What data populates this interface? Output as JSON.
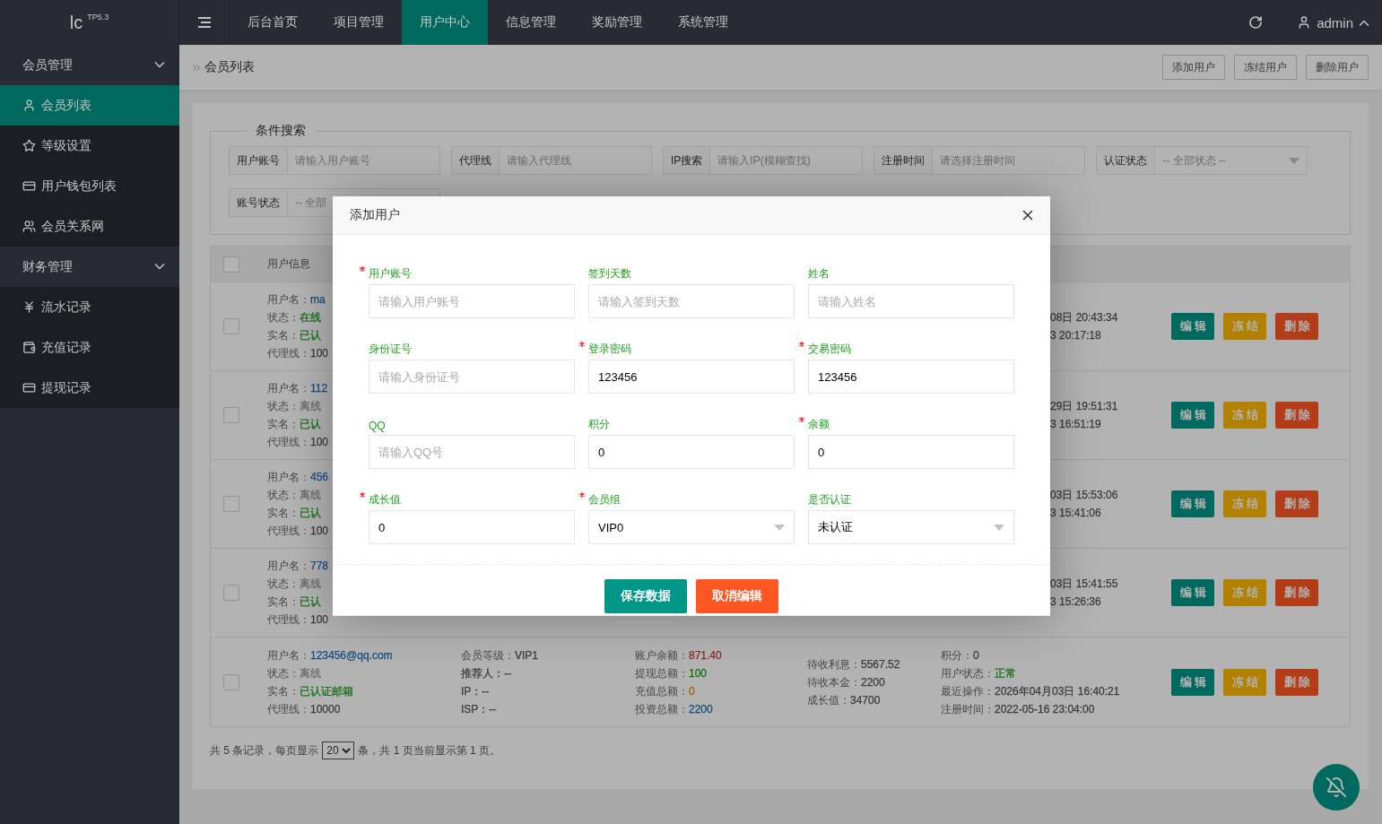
{
  "topbar": {
    "logo": "lc",
    "version": "TP5.3",
    "nav": [
      {
        "label": "后台首页",
        "selected": false
      },
      {
        "label": "项目管理",
        "selected": false
      },
      {
        "label": "用户中心",
        "selected": true
      },
      {
        "label": "信息管理",
        "selected": false
      },
      {
        "label": "奖励管理",
        "selected": false
      },
      {
        "label": "系统管理",
        "selected": false
      }
    ],
    "user": "admin"
  },
  "sidebar": {
    "groups": [
      {
        "label": "会员管理",
        "expanded": true,
        "children": [
          {
            "label": "会员列表",
            "selected": true
          },
          {
            "label": "等级设置",
            "selected": false
          },
          {
            "label": "用户钱包列表",
            "selected": false
          },
          {
            "label": "会员关系网",
            "selected": false
          }
        ]
      },
      {
        "label": "财务管理",
        "expanded": true,
        "children": [
          {
            "label": "流水记录",
            "selected": false
          },
          {
            "label": "充值记录",
            "selected": false
          },
          {
            "label": "提现记录",
            "selected": false
          }
        ]
      }
    ]
  },
  "breadcrumb": "会员列表",
  "toolbar_buttons": [
    "添加用户",
    "冻结用户",
    "删除用户"
  ],
  "search": {
    "legend": "条件搜索",
    "rows": [
      [
        {
          "label": "用户账号",
          "kind": "input",
          "placeholder": "请输入用户账号"
        },
        {
          "label": "代理线",
          "kind": "input",
          "placeholder": "请输入代理线"
        },
        {
          "label": "IP搜索",
          "kind": "input",
          "placeholder": "请输入IP(模糊查找)"
        },
        {
          "label": "注册时间",
          "kind": "input",
          "placeholder": "请选择注册时间"
        },
        {
          "label": "认证状态",
          "kind": "select",
          "value": "-- 全部状态 --"
        }
      ],
      [
        {
          "label": "账号状态",
          "kind": "select_cut",
          "value": "-- 全部"
        }
      ]
    ]
  },
  "table": {
    "header_checked": false,
    "columns": [
      "用户信息"
    ],
    "rows": [
      {
        "kind": "partial",
        "checked": false,
        "cells": [
          [
            {
              "label": "用户名：",
              "value": "ma",
              "color": "#154d81"
            },
            {
              "label": "状态：",
              "value": "在线",
              "color": "#126d12"
            },
            {
              "label": "实名：",
              "value": "已认",
              "color": "#126d12"
            },
            {
              "label": "代理线：",
              "value": "100",
              "color": "#3b3b3b"
            }
          ],
          [
            {
              "value": "08日 20:43:34"
            },
            {
              "value": "3 20:17:18"
            }
          ]
        ],
        "actions": [
          "编辑",
          "冻结",
          "删除"
        ]
      },
      {
        "kind": "partial",
        "checked": false,
        "cells": [
          [
            {
              "label": "用户名：",
              "value": "112",
              "color": "#154d81"
            },
            {
              "label": "状态：",
              "value": "离线",
              "color": "#6b6b6b"
            },
            {
              "label": "实名：",
              "value": "已认",
              "color": "#126d12"
            },
            {
              "label": "代理线：",
              "value": "100",
              "color": "#3b3b3b"
            }
          ],
          [
            {
              "value": "29日 19:51:31"
            },
            {
              "value": "3 16:51:19"
            }
          ]
        ],
        "actions": [
          "编辑",
          "冻结",
          "删除"
        ]
      },
      {
        "kind": "partial",
        "checked": false,
        "cells": [
          [
            {
              "label": "用户名：",
              "value": "456",
              "color": "#154d81"
            },
            {
              "label": "状态：",
              "value": "离线",
              "color": "#6b6b6b"
            },
            {
              "label": "实名：",
              "value": "已认",
              "color": "#126d12"
            },
            {
              "label": "代理线：",
              "value": "100",
              "color": "#3b3b3b"
            }
          ],
          [
            {
              "value": "03日 15:53:06"
            },
            {
              "value": "3 15:41:06"
            }
          ]
        ],
        "actions": [
          "编辑",
          "冻结",
          "删除"
        ]
      },
      {
        "kind": "partial",
        "checked": false,
        "cells": [
          [
            {
              "label": "用户名：",
              "value": "778",
              "color": "#154d81"
            },
            {
              "label": "状态：",
              "value": "离线",
              "color": "#6b6b6b"
            },
            {
              "label": "实名：",
              "value": "已认",
              "color": "#126d12"
            },
            {
              "label": "代理线：",
              "value": "100",
              "color": "#3b3b3b"
            }
          ],
          [
            {
              "value": "03日 15:41:55"
            },
            {
              "value": "3 15:26:36"
            }
          ]
        ],
        "actions": [
          "编辑",
          "冻结",
          "删除"
        ]
      },
      {
        "kind": "full",
        "checked": false,
        "cells": [
          [
            {
              "label": "用户名：",
              "value": "123456@qq.com",
              "color": "#154d81"
            },
            {
              "label": "状态：",
              "value": "离线",
              "color": "#6b6b6b"
            },
            {
              "label": "实名：",
              "value": "已认证邮箱",
              "color": "#126d12"
            },
            {
              "label": "代理线：",
              "value": "10000",
              "color": "#3b3b3b"
            }
          ],
          [
            {
              "label": "会员等级：",
              "value": "VIP1",
              "color": "#3b3b3b"
            },
            {
              "value": "推荐人：--"
            },
            {
              "value": "IP：--"
            },
            {
              "value": "ISP：--"
            }
          ],
          [
            {
              "label": "账户余额：",
              "value": "871.40",
              "color": "#882929"
            },
            {
              "label": "提现总额：",
              "value": "100",
              "color": "#126d12"
            },
            {
              "label": "充值总额：",
              "value": "0",
              "color": "#9d6100"
            },
            {
              "label": "投资总额：",
              "value": "2200",
              "color": "#154d81"
            }
          ],
          [
            {
              "label": "待收利息：",
              "value": "5567.52",
              "color": "#3b3b3b"
            },
            {
              "label": "待收本金：",
              "value": "2200",
              "color": "#3b3b3b"
            },
            {
              "label": "成长值：",
              "value": "34700",
              "color": "#3b3b3b"
            }
          ],
          [
            {
              "label": "积分：",
              "value": "0",
              "color": "#3b3b3b"
            },
            {
              "label": "用户状态：",
              "value": "正常",
              "color": "#126d12"
            },
            {
              "label": "最近操作：",
              "value": "2026年04月03日 16:40:21",
              "color": "#3b3b3b"
            },
            {
              "label": "注册时间：",
              "value": "2022-05-16 23:04:00",
              "color": "#3b3b3b"
            }
          ]
        ],
        "actions": [
          "编辑",
          "冻结",
          "删除"
        ]
      }
    ]
  },
  "pager": {
    "before": "共 5 条记录，每页显示",
    "page_size": "20",
    "after": "条，共 1 页当前显示第 1 页。"
  },
  "modal": {
    "title": "添加用户",
    "fields": [
      {
        "label": "用户账号",
        "required": true,
        "kind": "input",
        "placeholder": "请输入用户账号"
      },
      {
        "label": "签到天数",
        "required": false,
        "kind": "input",
        "placeholder": "请输入签到天数"
      },
      {
        "label": "姓名",
        "required": false,
        "kind": "input",
        "placeholder": "请输入姓名"
      },
      {
        "label": "身份证号",
        "required": false,
        "kind": "input",
        "placeholder": "请输入身份证号"
      },
      {
        "label": "登录密码",
        "required": true,
        "kind": "input",
        "value": "123456"
      },
      {
        "label": "交易密码",
        "required": true,
        "kind": "input",
        "value": "123456"
      },
      {
        "label": "QQ",
        "required": false,
        "kind": "input",
        "placeholder": "请输入QQ号"
      },
      {
        "label": "积分",
        "required": false,
        "kind": "input",
        "value": "0"
      },
      {
        "label": "余额",
        "required": true,
        "kind": "input",
        "value": "0"
      },
      {
        "label": "成长值",
        "required": true,
        "kind": "input",
        "value": "0"
      },
      {
        "label": "会员组",
        "required": true,
        "kind": "select",
        "value": "VIP0"
      },
      {
        "label": "是否认证",
        "required": false,
        "kind": "select",
        "value": "未认证"
      }
    ],
    "buttons": [
      {
        "label": "保存数据",
        "kind": "primary"
      },
      {
        "label": "取消编辑",
        "kind": "danger"
      }
    ]
  }
}
